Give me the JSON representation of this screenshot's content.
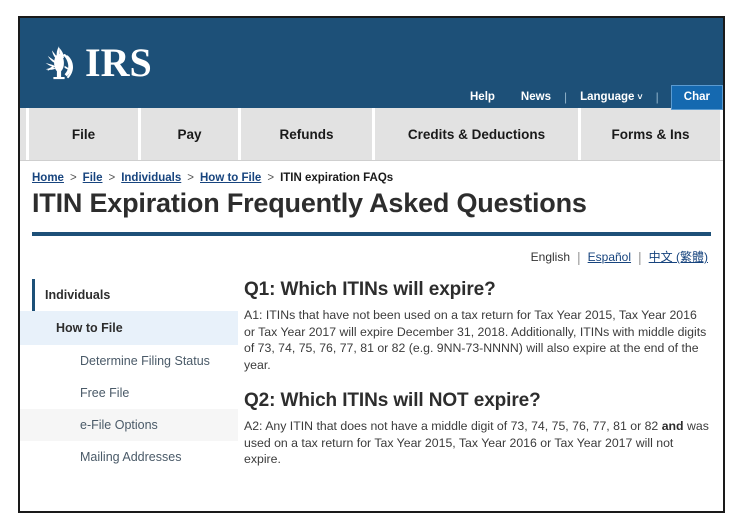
{
  "header": {
    "logo_text": "IRS",
    "seal_icon": "irs-eagle-seal-icon",
    "utility": {
      "help": "Help",
      "news": "News",
      "language": "Language",
      "language_caret": "˅",
      "separator": "|",
      "charities_button": "Char"
    }
  },
  "main_nav": {
    "tabs": [
      {
        "label": "File"
      },
      {
        "label": "Pay"
      },
      {
        "label": "Refunds"
      },
      {
        "label": "Credits & Deductions"
      },
      {
        "label": "Forms & Ins"
      }
    ]
  },
  "breadcrumb": {
    "separator": ">",
    "items": [
      {
        "label": "Home",
        "link": true
      },
      {
        "label": "File",
        "link": true
      },
      {
        "label": "Individuals",
        "link": true
      },
      {
        "label": "How to File",
        "link": true
      },
      {
        "label": "ITIN expiration FAQs",
        "link": false
      }
    ]
  },
  "page": {
    "title": "ITIN Expiration Frequently Asked Questions"
  },
  "language_row": {
    "divider": "|",
    "current": "English",
    "options": [
      {
        "label": "Español"
      },
      {
        "label": "中文 (繁體)"
      }
    ]
  },
  "sidebar": {
    "items": [
      {
        "label": "Individuals",
        "level": "top"
      },
      {
        "label": "How to File",
        "level": "active"
      },
      {
        "label": "Determine Filing Status",
        "level": "sub"
      },
      {
        "label": "Free File",
        "level": "sub"
      },
      {
        "label": "e-File Options",
        "level": "sub-hover"
      },
      {
        "label": "Mailing Addresses",
        "level": "sub"
      }
    ]
  },
  "faq": {
    "q1": {
      "question": "Q1: Which ITINs will expire?",
      "answer_part1": "A1: ITINs that have not been used on a tax return for Tax Year 2015, Tax Year 2016 or Tax Year 2017 will expire December 31, 2018. Additionally, ITINs with middle digits of 73, 74, 75, 76, 77, 81 or 82  (e.g. 9NN-73-NNNN) will also expire at the end of the year."
    },
    "q2": {
      "question": "Q2: Which ITINs will NOT expire?",
      "answer_before_bold": "A2: Any ITIN that does not have a middle digit of 73, 74, 75, 76, 77, 81 or 82 ",
      "answer_bold": "and",
      "answer_after_bold": " was used on a tax return for Tax Year 2015, Tax Year 2016 or Tax Year 2017 will not expire."
    }
  },
  "colors": {
    "irs_blue": "#1d5078",
    "button_blue": "#1569b0",
    "link_blue": "#17447e",
    "nav_gray": "#e2e2e2",
    "sidebar_active": "#e8f1fa"
  }
}
